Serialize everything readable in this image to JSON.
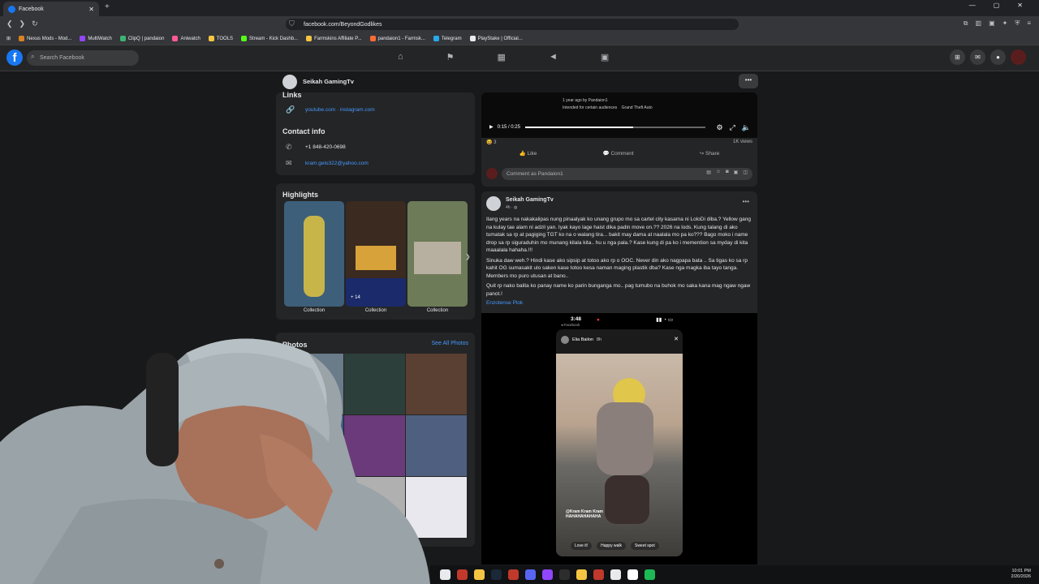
{
  "browser": {
    "tab_title": "Facebook",
    "url": "facebook.com/BeyondGodlikes",
    "bookmarks": [
      {
        "label": "Nexus Mods - Mod...",
        "color": "#d98324"
      },
      {
        "label": "MultiWatch",
        "color": "#9146ff"
      },
      {
        "label": "ClipQ | pandaion",
        "color": "#3cb371"
      },
      {
        "label": "Aniwatch",
        "color": "#ff5b92"
      },
      {
        "label": "TOOLS",
        "color": "#f4c542"
      },
      {
        "label": "Stream - Kick Dashb...",
        "color": "#53fc18"
      },
      {
        "label": "Farmskins Affiliate P...",
        "color": "#f4c542"
      },
      {
        "label": "pandaion1 - Farmsk...",
        "color": "#ff6b35"
      },
      {
        "label": "Telegram",
        "color": "#29a9eb"
      },
      {
        "label": "PlayStake | Official...",
        "color": "#e8eaed"
      }
    ]
  },
  "fb": {
    "search_placeholder": "Search Facebook"
  },
  "profile": {
    "name": "Seikah GamingTv"
  },
  "links": {
    "heading": "Links",
    "social": "youtube.com · instagram.com"
  },
  "contact": {
    "heading": "Contact info",
    "phone": "+1 848-420-0698",
    "email": "kram.gelo322@yahoo.com"
  },
  "highlights": {
    "heading": "Highlights",
    "items": [
      {
        "label": "Collection",
        "color": "#3d5f7a"
      },
      {
        "label": "Collection",
        "badge": "+ 14",
        "color": "#3a2a1f"
      },
      {
        "label": "Collection",
        "color": "#6d7b58"
      }
    ]
  },
  "photos": {
    "heading": "Photos",
    "see_all": "See All Photos",
    "tiles": [
      "#6a7b8a",
      "#2d3f3a",
      "#5a4033",
      "#3b5a8a",
      "#6a3a7a",
      "#4f5f7f",
      "#8a8a8a",
      "#b0b0b0",
      "#e8e8ee"
    ]
  },
  "video_post": {
    "meta_line1": "1 year ago by Pandaion1",
    "meta_line2": "Intended for certain audiences",
    "meta_game": "Grand Theft Auto",
    "time": "0:15 / 0:25",
    "progress": 0.6,
    "reaction_count": "3",
    "views": "1K views",
    "like": "Like",
    "comment": "Comment",
    "share": "Share",
    "comment_placeholder": "Comment as Pandaion1"
  },
  "post": {
    "author": "Seikah GamingTv",
    "meta": "4h · ",
    "paragraph1": "Ilang years na nakakalipas nung pinaalyak ko unang grupo mo sa cartel  city kasama ni LoloDi diba.? Yellow gang na kulay tae alam ni adzil yan. Iyak kayo lage haist dika padin move on.?? 2026 na lods. Kung talang di ako tumatak sa rp at pagiging TGT ko na o walang tira... bakit may dama at naalala mo pa ko??? Bago moko i name drop sa rp siguraduhin mo munang kilala kita.. hu u nga pala.? Kase kung di pa ko i memention sa myday di kita maaalala hahaha.!!!",
    "paragraph2": "Sinuka daw weh.? Hindi kase ako sipsip at totoo ako rp o OOC. Never din ako nagpapa bata .. Sa tigas ko sa rp kahit OG sumasakit ulo saken kase totoo kesa naman maging plastik dba? Kase nga magka iba tayo tanga. Members mo puro  utusan at bano..",
    "paragraph3": "Quit rp nako balita ko panay name ko parin bunganga mo.. pag tumubo na buhok mo saka kana mag ngaw ngaw panot.!",
    "tagged": "Enzotense Plok",
    "story": {
      "time": "3:48",
      "back": "◂ Facebook",
      "user": "Elia Bailon",
      "age": "8h",
      "caption_line1": "@Kram Kram Kram",
      "caption_line2": "HAHAHAHAHAHA",
      "buttons": [
        "Love it!",
        "Happy walk",
        "Sweet spot"
      ]
    }
  },
  "tray": {
    "time": "10:01 PM",
    "date": "2/20/2026"
  },
  "taskbar_icons": [
    "#e8eaed",
    "#c0392b",
    "#f4c542",
    "#1b2838",
    "#c0392b",
    "#5865f2",
    "#9146ff",
    "#2d2d2d",
    "#f4c542",
    "#c0392b",
    "#e8eaed",
    "#ffffff",
    "#1db954"
  ]
}
